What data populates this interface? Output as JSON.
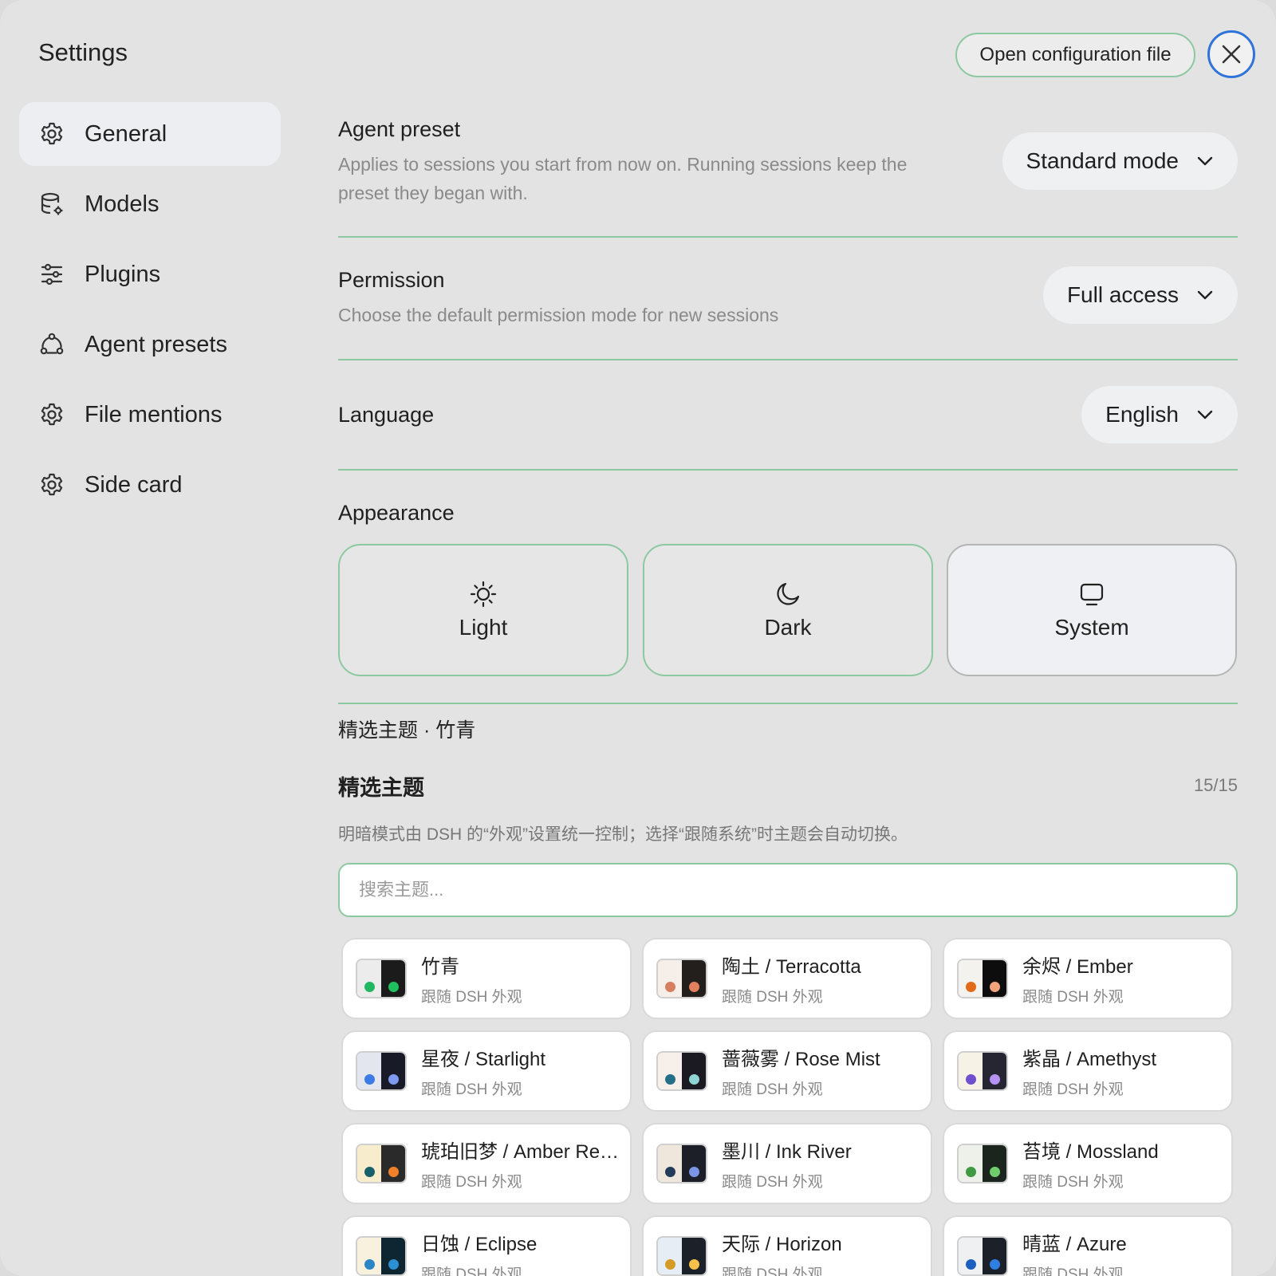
{
  "header": {
    "title": "Settings",
    "open_config_label": "Open configuration file",
    "close_icon": "close-icon"
  },
  "sidebar": {
    "items": [
      {
        "label": "General",
        "icon": "gear-icon",
        "active": true
      },
      {
        "label": "Models",
        "icon": "database-gear-icon",
        "active": false
      },
      {
        "label": "Plugins",
        "icon": "sliders-icon",
        "active": false
      },
      {
        "label": "Agent presets",
        "icon": "share-nodes-icon",
        "active": false
      },
      {
        "label": "File mentions",
        "icon": "gear-icon",
        "active": false
      },
      {
        "label": "Side card",
        "icon": "gear-icon",
        "active": false
      }
    ]
  },
  "general": {
    "agent_preset": {
      "title": "Agent preset",
      "description": "Applies to sessions you start from now on. Running sessions keep the preset they began with.",
      "value": "Standard mode"
    },
    "permission": {
      "title": "Permission",
      "description": "Choose the default permission mode for new sessions",
      "value": "Full access"
    },
    "language": {
      "title": "Language",
      "value": "English"
    },
    "appearance": {
      "title": "Appearance",
      "modes": [
        {
          "label": "Light",
          "icon": "sun-icon"
        },
        {
          "label": "Dark",
          "icon": "moon-icon"
        },
        {
          "label": "System",
          "icon": "monitor-icon"
        }
      ],
      "selected": "System"
    }
  },
  "themes": {
    "current": "精选主题 · 竹青",
    "heading": "精选主题",
    "count": "15/15",
    "note": "明暗模式由 DSH 的“外观”设置统一控制；选择“跟随系统”时主题会自动切换。",
    "search_placeholder": "搜索主题...",
    "items": [
      {
        "name": "竹青",
        "sub": "跟随 DSH 外观",
        "light_bg": "#ececec",
        "dark_bg": "#1b1b1b",
        "dot_light": "#1fb860",
        "dot_dark": "#1fc15f"
      },
      {
        "name": "陶土 / Terracotta",
        "sub": "跟随 DSH 外观",
        "light_bg": "#f6efe9",
        "dark_bg": "#221f1c",
        "dot_light": "#d77e60",
        "dot_dark": "#e2805e"
      },
      {
        "name": "余烬 / Ember",
        "sub": "跟随 DSH 外观",
        "light_bg": "#f4f2ef",
        "dark_bg": "#0d0d0d",
        "dot_light": "#e06a1a",
        "dot_dark": "#f3a37a"
      },
      {
        "name": "星夜 / Starlight",
        "sub": "跟随 DSH 外观",
        "light_bg": "#e3e6ee",
        "dark_bg": "#181a27",
        "dot_light": "#3c7ae5",
        "dot_dark": "#7e9af0"
      },
      {
        "name": "蔷薇雾 / Rose Mist",
        "sub": "跟随 DSH 外观",
        "light_bg": "#f6efea",
        "dark_bg": "#1b1a23",
        "dot_light": "#256e87",
        "dot_dark": "#8fd3d4"
      },
      {
        "name": "紫晶 / Amethyst",
        "sub": "跟随 DSH 外观",
        "light_bg": "#f6f3e6",
        "dark_bg": "#262633",
        "dot_light": "#6f4fd0",
        "dot_dark": "#b592f4"
      },
      {
        "name": "琥珀旧梦 / Amber Reverie",
        "sub": "跟随 DSH 外观",
        "light_bg": "#f7eccb",
        "dark_bg": "#2a2a2a",
        "dot_light": "#15606a",
        "dot_dark": "#f2802a"
      },
      {
        "name": "墨川 / Ink River",
        "sub": "跟随 DSH 外观",
        "light_bg": "#efe6dc",
        "dark_bg": "#1c1f27",
        "dot_light": "#223c5a",
        "dot_dark": "#7a95e6"
      },
      {
        "name": "苔境 / Mossland",
        "sub": "跟随 DSH 外观",
        "light_bg": "#eef0ea",
        "dark_bg": "#1b241d",
        "dot_light": "#3f9a43",
        "dot_dark": "#6fcd6c"
      },
      {
        "name": "日蚀 / Eclipse",
        "sub": "跟随 DSH 外观",
        "light_bg": "#f8f1dd",
        "dark_bg": "#0e2631",
        "dot_light": "#2b86c8",
        "dot_dark": "#2b8fd4"
      },
      {
        "name": "天际 / Horizon",
        "sub": "跟随 DSH 外观",
        "light_bg": "#e6edf4",
        "dark_bg": "#1c2029",
        "dot_light": "#d49b26",
        "dot_dark": "#f4c24a"
      },
      {
        "name": "晴蓝 / Azure",
        "sub": "跟随 DSH 外观",
        "light_bg": "#eef0f2",
        "dark_bg": "#1b2029",
        "dot_light": "#1d5fbf",
        "dot_dark": "#2e7fe0"
      }
    ]
  }
}
